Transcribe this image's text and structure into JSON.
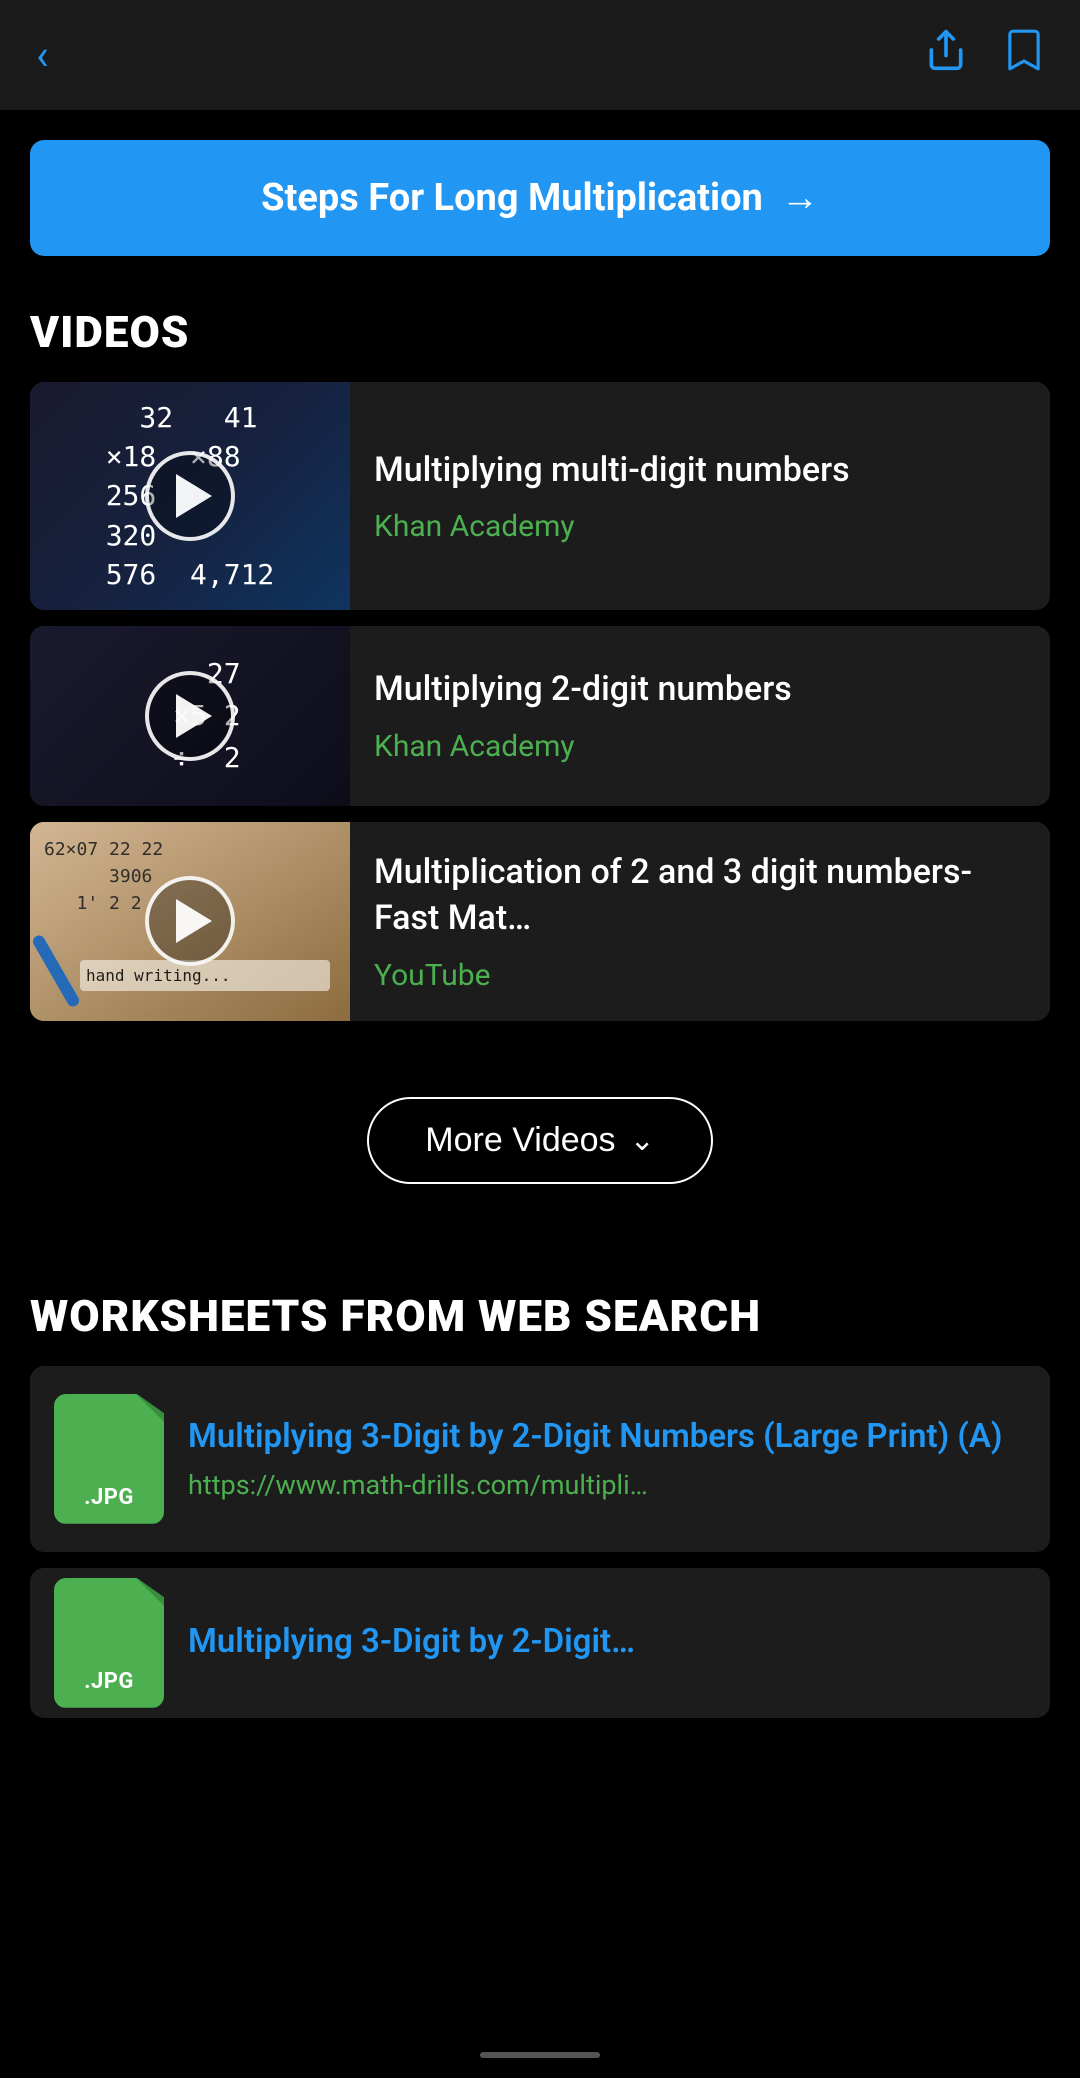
{
  "header": {
    "back_label": "‹",
    "share_icon": "share",
    "bookmark_icon": "bookmark"
  },
  "cta": {
    "label": "Steps For Long Multiplication",
    "arrow": "→"
  },
  "videos_section": {
    "heading": "VIDEOS",
    "items": [
      {
        "title": "Multiplying multi-digit numbers",
        "source": "Khan Academy",
        "thumbnail_type": "math",
        "math_lines": [
          "  32    41",
          "×18   ×88",
          "256",
          "320",
          "576  4,712"
        ]
      },
      {
        "title": "Multiplying 2-digit numbers",
        "source": "Khan Academy",
        "thumbnail_type": "math2",
        "math_lines": [
          "      27",
          "   ×5 2",
          "  ÷  2"
        ]
      },
      {
        "title": "Multiplication of 2 and 3 digit numbers-Fast Mat…",
        "source": "YouTube",
        "thumbnail_type": "photo"
      }
    ],
    "more_button": "More Videos"
  },
  "worksheets_section": {
    "heading": "WORKSHEETS FROM WEB SEARCH",
    "items": [
      {
        "file_ext": ".JPG",
        "title": "Multiplying 3-Digit by 2-Digit Numbers (Large Print) (A)",
        "url": "https://www.math-drills.com/multipli…"
      },
      {
        "file_ext": ".JPG",
        "title": "Multiplying 3-Digit by 2-Digit…",
        "url": ""
      }
    ]
  }
}
